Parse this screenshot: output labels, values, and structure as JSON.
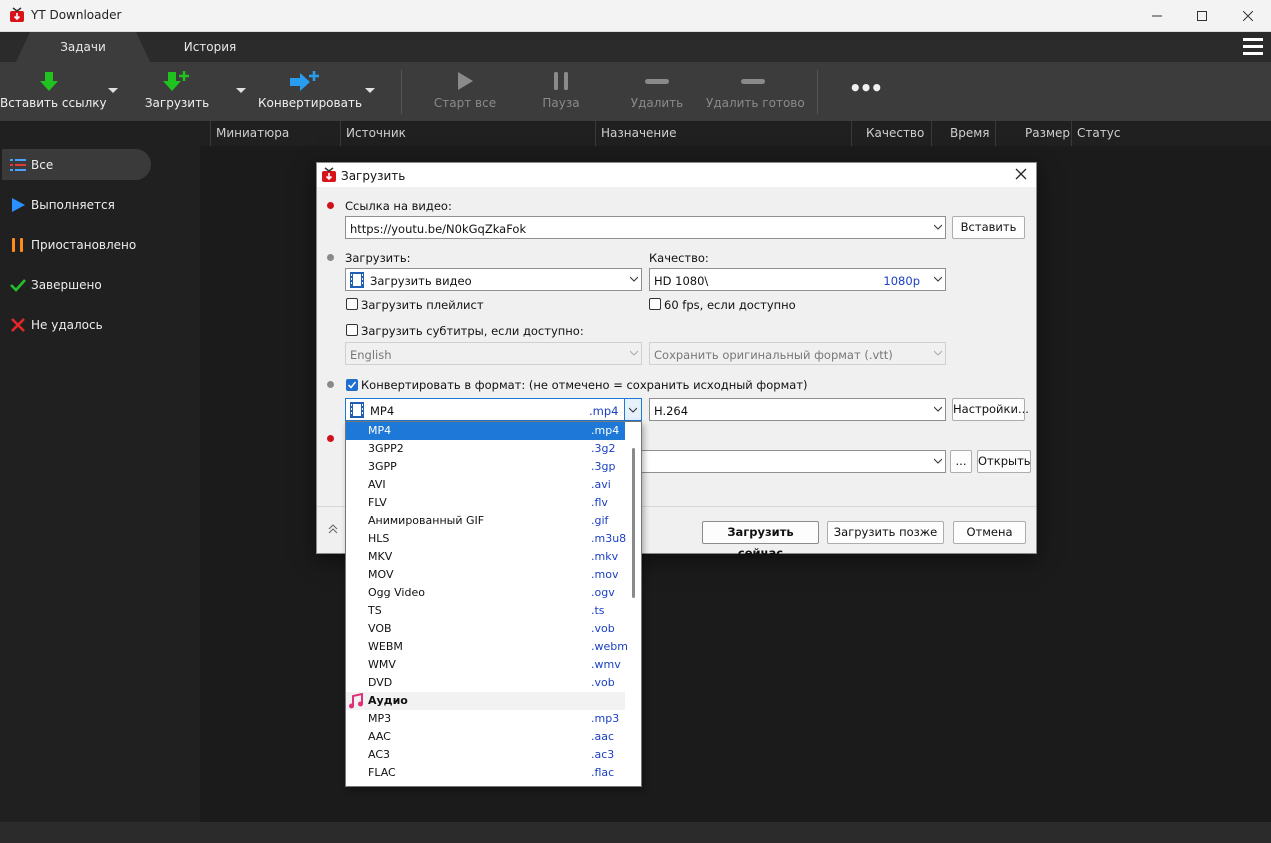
{
  "window": {
    "title": "YT Downloader"
  },
  "tabs": [
    {
      "label": "Задачи"
    },
    {
      "label": "История"
    }
  ],
  "toolbar": {
    "paste_link": "Вставить ссылку",
    "download": "Загрузить",
    "convert": "Конвертировать",
    "start_all": "Старт все",
    "pause": "Пауза",
    "delete": "Удалить",
    "delete_done": "Удалить готово",
    "more": "•••"
  },
  "columns": [
    "Миниатюра",
    "Источник",
    "Назначение",
    "Качество",
    "Время",
    "Размер",
    "Статус"
  ],
  "sidebar": {
    "items": [
      {
        "label": "Все",
        "icon": "list-icon",
        "color": "#4aa3ff"
      },
      {
        "label": "Выполняется",
        "icon": "play-icon",
        "color": "#2a8fff"
      },
      {
        "label": "Приостановлено",
        "icon": "pause-icon",
        "color": "#ff8c1a"
      },
      {
        "label": "Завершено",
        "icon": "checkmark-icon",
        "color": "#22c12a"
      },
      {
        "label": "Не удалось",
        "icon": "cross-icon",
        "color": "#e5262b"
      }
    ]
  },
  "dialog": {
    "title": "Загрузить",
    "url_label": "Ссылка на видео:",
    "url_value": "https://youtu.be/N0kGqZkaFok",
    "paste_button": "Вставить",
    "download_label": "Загрузить:",
    "download_value": "Загрузить видео",
    "quality_label": "Качество:",
    "quality_value": "HD 1080\\",
    "quality_badge": "1080p",
    "playlist_label": "Загрузить плейлист",
    "fps_label": "60 fps, если доступно",
    "subtitles_label": "Загрузить субтитры, если доступно:",
    "subtitle_lang": "English",
    "subtitle_format": "Сохранить оригинальный формат (.vtt)",
    "convert_label": "Конвертировать в формат: (не отмечено = сохранить исходный формат)",
    "format_value": "MP4",
    "format_ext": ".mp4",
    "codec_value": "H.264",
    "settings_button": "Настройки...",
    "browse_button": "...",
    "open_button": "Открыть",
    "download_now": "Загрузить сейчас",
    "download_later": "Загрузить позже",
    "cancel": "Отмена"
  },
  "format_options": [
    {
      "name": "MP4",
      "ext": ".mp4",
      "selected": true
    },
    {
      "name": "3GPP2",
      "ext": ".3g2"
    },
    {
      "name": "3GPP",
      "ext": ".3gp"
    },
    {
      "name": "AVI",
      "ext": ".avi"
    },
    {
      "name": "FLV",
      "ext": ".flv"
    },
    {
      "name": "Анимированный GIF",
      "ext": ".gif"
    },
    {
      "name": "HLS",
      "ext": ".m3u8"
    },
    {
      "name": "MKV",
      "ext": ".mkv"
    },
    {
      "name": "MOV",
      "ext": ".mov"
    },
    {
      "name": "Ogg Video",
      "ext": ".ogv"
    },
    {
      "name": "TS",
      "ext": ".ts"
    },
    {
      "name": "VOB",
      "ext": ".vob"
    },
    {
      "name": "WEBM",
      "ext": ".webm"
    },
    {
      "name": "WMV",
      "ext": ".wmv"
    },
    {
      "name": "DVD",
      "ext": ".vob"
    },
    {
      "name": "Аудио",
      "ext": "",
      "group": true
    },
    {
      "name": "MP3",
      "ext": ".mp3"
    },
    {
      "name": "AAC",
      "ext": ".aac"
    },
    {
      "name": "AC3",
      "ext": ".ac3"
    },
    {
      "name": "FLAC",
      "ext": ".flac"
    }
  ],
  "colors": {
    "accent": "#1e78d7",
    "required_dot": "#d0101a",
    "green_arrow": "#1fc21f",
    "blue_arrow": "#2a9cf0"
  }
}
